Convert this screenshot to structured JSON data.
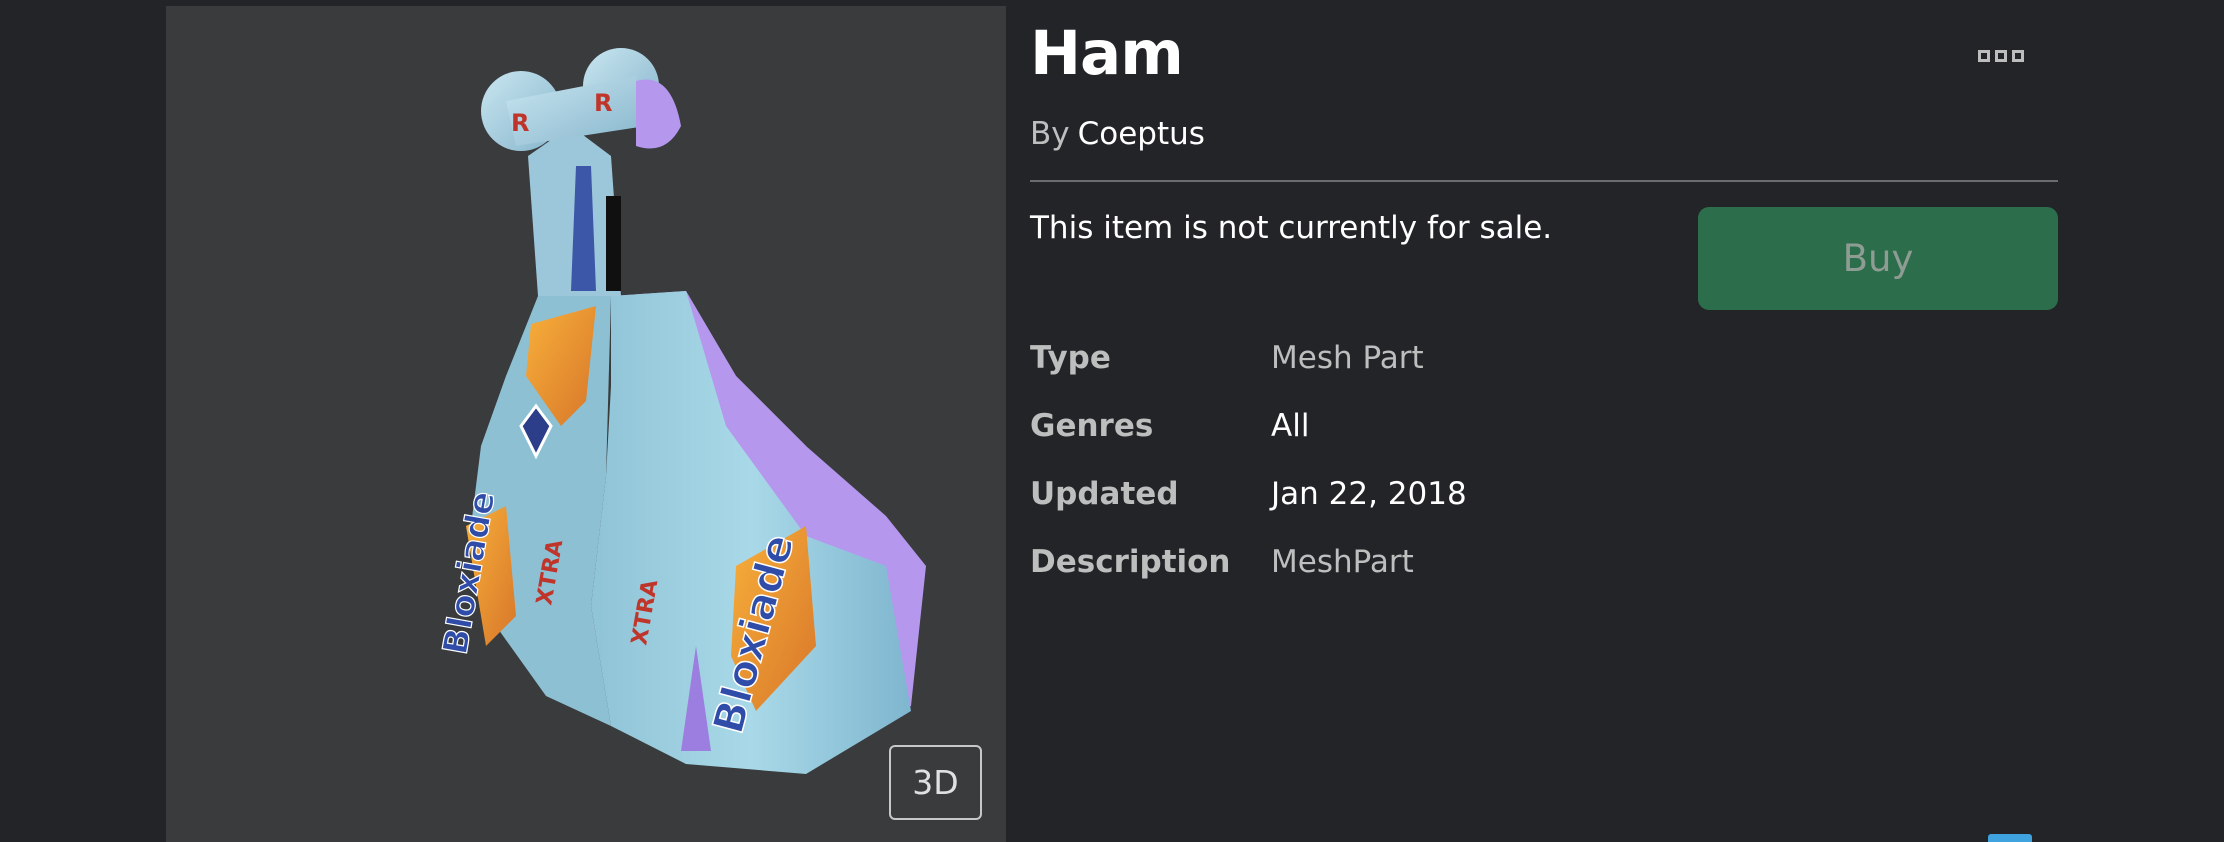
{
  "item": {
    "title": "Ham",
    "by_label": "By",
    "creator": "Coeptus",
    "sale_status": "This item is not currently for sale.",
    "buy_label": "Buy",
    "view_toggle_label": "3D"
  },
  "details": [
    {
      "label": "Type",
      "value": "Mesh Part"
    },
    {
      "label": "Genres",
      "value": "All"
    },
    {
      "label": "Updated",
      "value": "Jan 22, 2018"
    },
    {
      "label": "Description",
      "value": "MeshPart"
    }
  ],
  "colors": {
    "background": "#232427",
    "panel": "#393b3d",
    "buy_button": "#2c6e4b",
    "accent": "#3fa3e0"
  },
  "icons": {
    "more_options": "more-options-icon"
  }
}
